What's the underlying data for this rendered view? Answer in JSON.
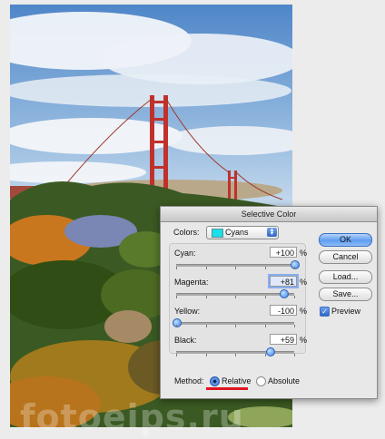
{
  "watermark": "fotoeips.ru",
  "dialog": {
    "title": "Selective Color",
    "colors_label": "Colors:",
    "colors_value": "Cyans",
    "swatch_color": "#18e0e6",
    "sliders": [
      {
        "label": "Cyan:",
        "value": "+100",
        "level": 100
      },
      {
        "label": "Magenta:",
        "value": "+81",
        "level": 81
      },
      {
        "label": "Yellow:",
        "value": "-100",
        "level": -100
      },
      {
        "label": "Black:",
        "value": "+59",
        "level": 59
      }
    ],
    "percent": "%",
    "buttons": {
      "ok": "OK",
      "cancel": "Cancel",
      "load": "Load...",
      "save": "Save..."
    },
    "preview_label": "Preview",
    "preview_checked": true,
    "method_label": "Method:",
    "relative_label": "Relative",
    "absolute_label": "Absolute",
    "selected_method": "Relative",
    "accent_color": "#e0151e"
  }
}
